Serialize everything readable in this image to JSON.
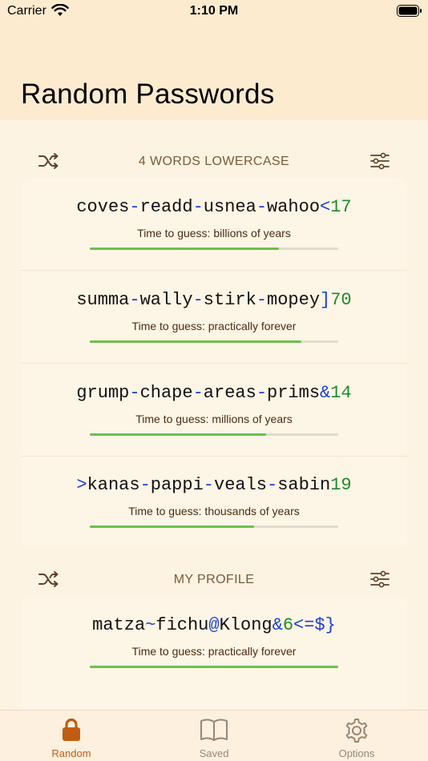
{
  "status_bar": {
    "carrier": "Carrier",
    "time": "1:10 PM"
  },
  "header": {
    "title": "Random Passwords"
  },
  "sections": [
    {
      "title": "4 WORDS LOWERCASE",
      "passwords": [
        {
          "segments": [
            [
              "coves",
              "w"
            ],
            [
              "-",
              "s"
            ],
            [
              "readd",
              "w"
            ],
            [
              "-",
              "s"
            ],
            [
              "usnea",
              "w"
            ],
            [
              "-",
              "s"
            ],
            [
              "wahoo",
              "w"
            ],
            [
              "<",
              "s"
            ],
            [
              "17",
              "n"
            ]
          ],
          "strength": "Time to guess: billions of years",
          "level": 0.76
        },
        {
          "segments": [
            [
              "summa",
              "w"
            ],
            [
              "-",
              "s"
            ],
            [
              "wally",
              "w"
            ],
            [
              "-",
              "s"
            ],
            [
              "stirk",
              "w"
            ],
            [
              "-",
              "s"
            ],
            [
              "mopey",
              "w"
            ],
            [
              "]",
              "s"
            ],
            [
              "70",
              "n"
            ]
          ],
          "strength": "Time to guess: practically forever",
          "level": 0.85
        },
        {
          "segments": [
            [
              "grump",
              "w"
            ],
            [
              "-",
              "s"
            ],
            [
              "chape",
              "w"
            ],
            [
              "-",
              "s"
            ],
            [
              "areas",
              "w"
            ],
            [
              "-",
              "s"
            ],
            [
              "prims",
              "w"
            ],
            [
              "&",
              "s"
            ],
            [
              "14",
              "n"
            ]
          ],
          "strength": "Time to guess: millions of years",
          "level": 0.71
        },
        {
          "segments": [
            [
              ">",
              "s"
            ],
            [
              "kanas",
              "w"
            ],
            [
              "-",
              "s"
            ],
            [
              "pappi",
              "w"
            ],
            [
              "-",
              "s"
            ],
            [
              "veals",
              "w"
            ],
            [
              "-",
              "s"
            ],
            [
              "sabin",
              "w"
            ],
            [
              "19",
              "n"
            ]
          ],
          "strength": "Time to guess: thousands of years",
          "level": 0.66
        }
      ]
    },
    {
      "title": "MY PROFILE",
      "passwords": [
        {
          "segments": [
            [
              "matza",
              "w"
            ],
            [
              "~",
              "s"
            ],
            [
              "fichu",
              "w"
            ],
            [
              "@",
              "s"
            ],
            [
              "Klong",
              "w"
            ],
            [
              "&",
              "s"
            ],
            [
              "6",
              "n"
            ],
            [
              "<=$}",
              "s"
            ]
          ],
          "strength": "Time to guess: practically forever",
          "level": 1.0
        }
      ]
    }
  ],
  "tabs": [
    {
      "label": "Random",
      "icon": "lock-icon",
      "active": true
    },
    {
      "label": "Saved",
      "icon": "book-icon",
      "active": false
    },
    {
      "label": "Options",
      "icon": "gear-icon",
      "active": false
    }
  ],
  "colors": {
    "accent": "#c05d12",
    "separator": "#1b3fd6",
    "number": "#1f8a2b",
    "strength_bar": "#6cc04a",
    "inactive_tab": "#9a8770"
  }
}
